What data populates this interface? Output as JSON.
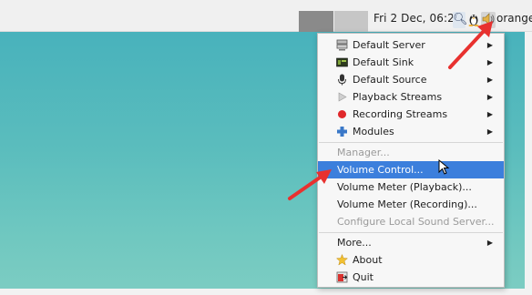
{
  "panel": {
    "clock": "Fri  2 Dec, 06:20",
    "user": "orange",
    "tray_icons": [
      "search-icon",
      "tux-icon",
      "volume-icon"
    ]
  },
  "menu": {
    "items": [
      {
        "label": "Default Server",
        "icon": "server-icon",
        "submenu": true
      },
      {
        "label": "Default Sink",
        "icon": "sink-icon",
        "submenu": true
      },
      {
        "label": "Default Source",
        "icon": "microphone-icon",
        "submenu": true
      },
      {
        "label": "Playback Streams",
        "icon": "play-icon",
        "submenu": true
      },
      {
        "label": "Recording Streams",
        "icon": "record-icon",
        "submenu": true
      },
      {
        "label": "Modules",
        "icon": "puzzle-icon",
        "submenu": true
      },
      {
        "label": "Manager...",
        "disabled": true
      },
      {
        "label": "Volume Control...",
        "selected": true
      },
      {
        "label": "Volume Meter (Playback)..."
      },
      {
        "label": "Volume Meter (Recording)..."
      },
      {
        "label": "Configure Local Sound Server...",
        "disabled": true
      },
      {
        "label": "More...",
        "submenu": true
      },
      {
        "label": "About",
        "icon": "star-icon"
      },
      {
        "label": "Quit",
        "icon": "quit-icon"
      }
    ]
  },
  "colors": {
    "selection": "#3c7fdc",
    "annotation_arrow": "#e8312f",
    "desktop": "#5bbdbd"
  }
}
